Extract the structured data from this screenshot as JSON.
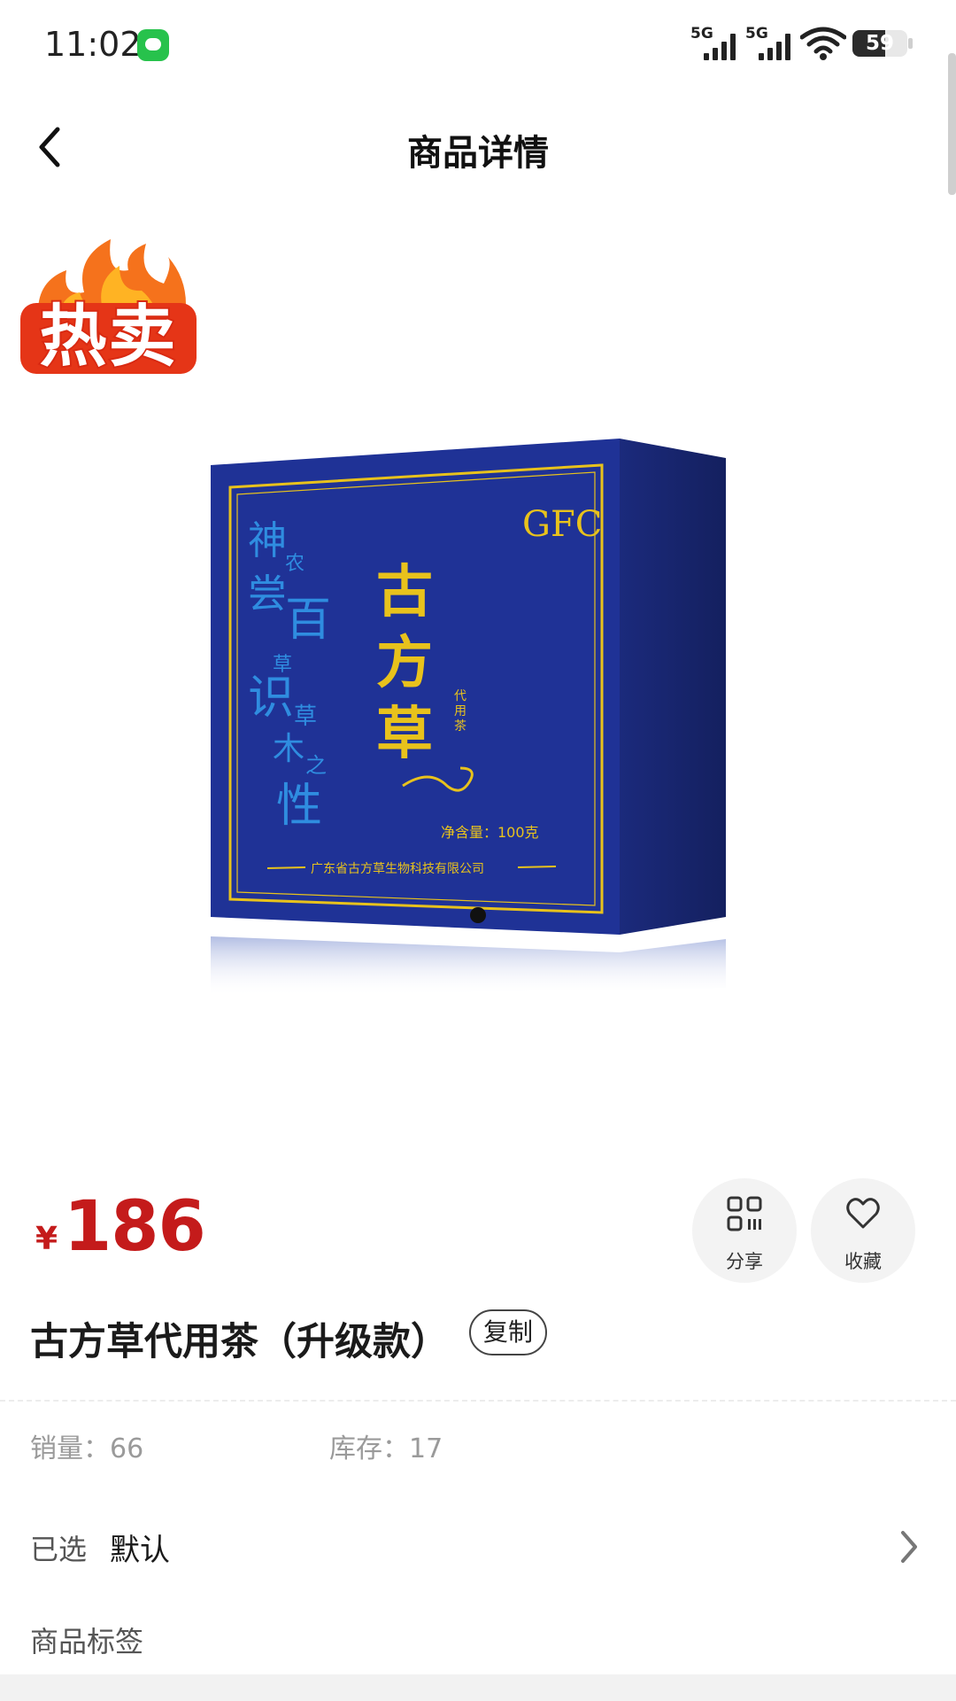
{
  "status_bar": {
    "time": "11:02",
    "signal1_label": "5G",
    "signal2_label": "5G",
    "battery_level": 59,
    "battery_text": "59"
  },
  "nav": {
    "title": "商品详情"
  },
  "gallery": {
    "badge_text": "热卖",
    "box": {
      "brand": "GFC",
      "vertical_text": [
        "神",
        "农",
        "尝",
        "百",
        "草",
        "识",
        "草",
        "木",
        "之",
        "性"
      ],
      "title_chars": [
        "古",
        "方",
        "草"
      ],
      "subtitle_chars": [
        "代",
        "用",
        "茶"
      ],
      "net_weight": "净含量：100克",
      "company": "广东省古方草生物科技有限公司"
    },
    "page_indicator_total": 1,
    "page_indicator_active": 1
  },
  "price": {
    "currency": "¥",
    "amount": "186"
  },
  "actions": {
    "share_label": "分享",
    "favorite_label": "收藏"
  },
  "product": {
    "name": "古方草代用茶（升级款）",
    "copy_label": "复制"
  },
  "stats": {
    "sales": "销量：66",
    "stock": "库存：17"
  },
  "selection": {
    "label": "已选",
    "value": "默认"
  },
  "tags": {
    "label": "商品标签"
  },
  "colors": {
    "price_red": "#c41b1b",
    "box_blue": "#1f3296",
    "gold": "#e8c21c"
  }
}
